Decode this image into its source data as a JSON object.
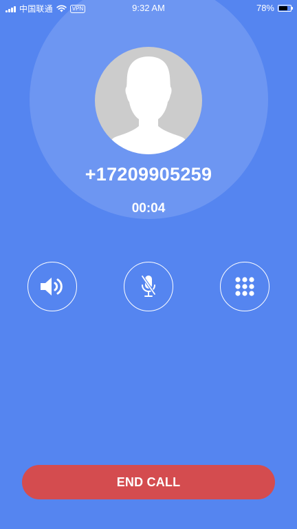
{
  "status_bar": {
    "carrier": "中国联通",
    "vpn": "VPN",
    "time": "9:32 AM",
    "battery_percent": "78%",
    "battery_level": 0.78
  },
  "call": {
    "number": "+17209905259",
    "duration": "00:04"
  },
  "controls": [
    {
      "name": "speaker",
      "icon": "speaker-icon"
    },
    {
      "name": "mute",
      "icon": "microphone-muted-icon"
    },
    {
      "name": "keypad",
      "icon": "dialpad-icon"
    }
  ],
  "end_call": {
    "label": "END CALL"
  },
  "colors": {
    "background": "#5585F0",
    "end_call": "#D44C4F",
    "avatar_bg": "#CCCCCC"
  }
}
